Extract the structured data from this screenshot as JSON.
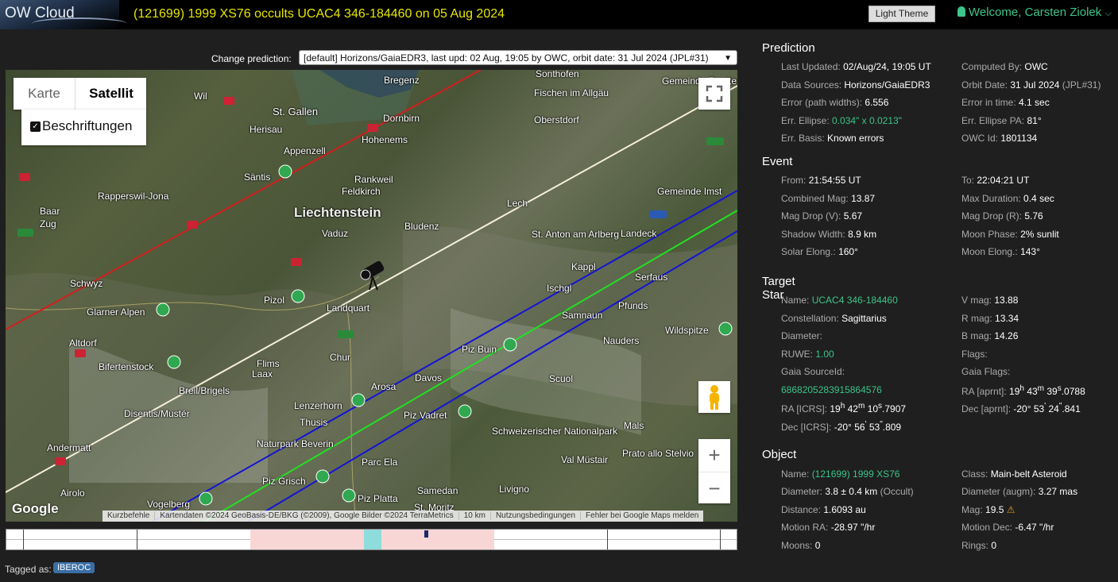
{
  "app": {
    "logo": "OW Cloud",
    "title": "(121699) 1999 XS76 occults UCAC4 346-184460 on 05 Aug 2024",
    "theme_button": "Light Theme",
    "welcome": "Welcome, Carsten Ziolek"
  },
  "prediction_select": {
    "label": "Change prediction:",
    "value": "[default] Horizons/GaiaEDR3, last upd: 02 Aug, 19:05 by OWC, orbit date: 31 Jul 2024 (JPL#31)"
  },
  "map": {
    "type_karte": "Karte",
    "type_satellit": "Satellit",
    "labels_toggle": "Beschriftungen",
    "google": "Google",
    "attribution": [
      "Kurzbefehle",
      "Kartendaten ©2024 GeoBasis-DE/BKG (©2009), Google Bilder ©2024 TerraMetrics",
      "10 km",
      "Nutzungsbedingungen",
      "Fehler bei Google Maps melden"
    ],
    "place_labels": [
      "Bregenz",
      "Sonthofen",
      "Gemeinde Reutte",
      "Wil",
      "St. Gallen",
      "Fischen im Allgäu",
      "Dornbirn",
      "Oberstdorf",
      "Herisau",
      "Hohenems",
      "Appenzell",
      "Säntis",
      "Rankweil",
      "Feldkirch",
      "Gemeinde Imst",
      "Rapperswil-Jona",
      "Baar",
      "Zug",
      "Liechtenstein",
      "Vaduz",
      "Lech",
      "Bludenz",
      "St. Anton am Arlberg",
      "Landeck",
      "Kappl",
      "Schwyz",
      "Ischgl",
      "Serfaus",
      "Pizol",
      "Landquart",
      "Pfunds",
      "Glarner Alpen",
      "Samnaun",
      "Wildspitze",
      "Altdorf",
      "Piz Buin",
      "Nauders",
      "Bifertenstock",
      "Flims",
      "Laax",
      "Chur",
      "Scuol",
      "Arosa",
      "Davos",
      "Breil/Brigels",
      "Lenzerhorn",
      "Piz Vadret",
      "Disentis/Mustér",
      "Thusis",
      "Schweizerischer Nationalpark",
      "Andermatt",
      "Naturpark Beverin",
      "Mals",
      "Parc Ela",
      "Val Müstair",
      "Prato allo Stelvio",
      "Airolo",
      "Piz Grisch",
      "Samedan",
      "Livigno",
      "Vogelberg",
      "Piz Platta",
      "St. Moritz"
    ]
  },
  "tagged": {
    "label": "Tagged as:",
    "tag": "IBEROC"
  },
  "prediction": {
    "title": "Prediction",
    "left": [
      {
        "k": "Last Updated:",
        "v": "02/Aug/24, 19:05 UT"
      },
      {
        "k": "Data Sources:",
        "v": "Horizons/GaiaEDR3"
      },
      {
        "k": "Error (path widths):",
        "v": "6.556"
      },
      {
        "k": "Err. Ellipse:",
        "v": "0.034\" x 0.0213\""
      },
      {
        "k": "Err. Basis:",
        "v": "Known errors"
      }
    ],
    "right": [
      {
        "k": "Computed By:",
        "v": "OWC"
      },
      {
        "k": "Orbit Date:",
        "v": "31 Jul 2024",
        "v2": "(JPL#31)"
      },
      {
        "k": "Error in time:",
        "v": "4.1 sec"
      },
      {
        "k": "Err. Ellipse PA:",
        "v": "81°"
      },
      {
        "k": "OWC Id:",
        "v": "1801134"
      }
    ]
  },
  "event": {
    "title": "Event",
    "left": [
      {
        "k": "From:",
        "v": "21:54:55 UT"
      },
      {
        "k": "Combined Mag:",
        "v": "13.87"
      },
      {
        "k": "Mag Drop (V):",
        "v": "5.67"
      },
      {
        "k": "Shadow Width:",
        "v": "8.9 km"
      },
      {
        "k": "Solar Elong.:",
        "v": "160°"
      }
    ],
    "right": [
      {
        "k": "To:",
        "v": "22:04:21 UT"
      },
      {
        "k": "Max Duration:",
        "v": "0.4 sec"
      },
      {
        "k": "Mag Drop (R):",
        "v": "5.76"
      },
      {
        "k": "Moon Phase:",
        "v": "2% sunlit"
      },
      {
        "k": "Moon Elong.:",
        "v": "143°"
      }
    ]
  },
  "target": {
    "title": "Target Star",
    "name_k": "Name:",
    "name_v": "UCAC4 346-184460",
    "const_k": "Constellation:",
    "const_v": "Sagittarius",
    "diam_k": "Diameter:",
    "ruwe_k": "RUWE:",
    "ruwe_v": "1.00",
    "gaia_k": "Gaia SourceId:",
    "gaia_v": "6868205283915864576",
    "ra_k": "RA [ICRS]:",
    "ra_h": "19",
    "ra_m": "42",
    "ra_s": "10",
    "ra_f": ".7907",
    "dec_k": "Dec [ICRS]:",
    "dec_d": "-20°",
    "dec_m": "56",
    "dec_s": "53",
    "dec_f": ".809",
    "vmag_k": "V mag:",
    "vmag_v": "13.88",
    "rmag_k": "R mag:",
    "rmag_v": "13.34",
    "bmag_k": "B mag:",
    "bmag_v": "14.26",
    "flags_k": "Flags:",
    "gflags_k": "Gaia Flags:",
    "raa_k": "RA [aprnt]:",
    "raa_h": "19",
    "raa_m": "43",
    "raa_s": "39",
    "raa_f": ".0788",
    "deca_k": "Dec [aprnt]:",
    "deca_d": "-20°",
    "deca_m": "53",
    "deca_s": "24",
    "deca_f": ".841"
  },
  "object": {
    "title": "Object",
    "left": [
      {
        "k": "Name:",
        "v": "(121699) 1999 XS76",
        "green": true
      },
      {
        "k": "Diameter:",
        "v": "3.8 ± 0.4 km",
        "v2": "(Occult)"
      },
      {
        "k": "Distance:",
        "v": "1.6093 au"
      },
      {
        "k": "Motion RA:",
        "v": "-28.97 \"/hr"
      },
      {
        "k": "Moons:",
        "v": "0"
      }
    ],
    "right": [
      {
        "k": "Class:",
        "v": "Main-belt Asteroid"
      },
      {
        "k": "Diameter (augm):",
        "v": "3.27 mas"
      },
      {
        "k": "Mag:",
        "v": "19.5"
      },
      {
        "k": "Motion Dec:",
        "v": "-6.47 \"/hr"
      },
      {
        "k": "Rings:",
        "v": "0"
      }
    ]
  },
  "icons": {
    "warn": "warning-icon",
    "user": "user-icon",
    "caret": "chevron-down-icon"
  }
}
